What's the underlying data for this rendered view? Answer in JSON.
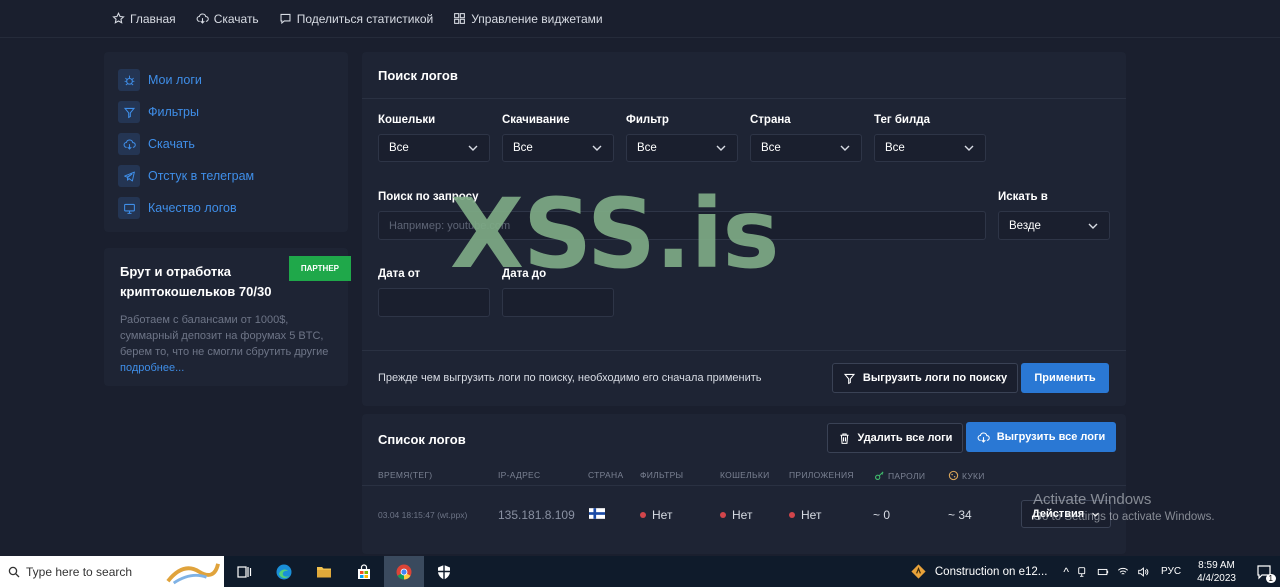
{
  "topnav": {
    "items": [
      {
        "label": "Главная",
        "icon": "star-icon"
      },
      {
        "label": "Скачать",
        "icon": "cloud-download-icon"
      },
      {
        "label": "Поделиться статистикой",
        "icon": "share-icon"
      },
      {
        "label": "Управление виджетами",
        "icon": "widgets-icon"
      }
    ]
  },
  "sidebar": {
    "items": [
      {
        "label": "Мои логи",
        "icon": "bug-icon"
      },
      {
        "label": "Фильтры",
        "icon": "filter-icon"
      },
      {
        "label": "Скачать",
        "icon": "cloud-download-icon"
      },
      {
        "label": "Отстук в телеграм",
        "icon": "telegram-icon"
      },
      {
        "label": "Качество логов",
        "icon": "monitor-icon"
      }
    ]
  },
  "promo": {
    "title": "Брут и отработка криптокошельков 70/30",
    "badge": "ПАРТНЕР",
    "text": "Работаем с балансами от 1000$, суммарный депозит на форумах 5 BTC, берем то, что не смогли сбрутить другие",
    "link": "подробнее..."
  },
  "search_panel": {
    "title": "Поиск логов",
    "filters": [
      {
        "label": "Кошельки",
        "value": "Все"
      },
      {
        "label": "Скачивание",
        "value": "Все"
      },
      {
        "label": "Фильтр",
        "value": "Все"
      },
      {
        "label": "Страна",
        "value": "Все"
      },
      {
        "label": "Тег билда",
        "value": "Все"
      }
    ],
    "query_label": "Поиск по запросу",
    "query_placeholder": "Например: youtube.com",
    "search_in_label": "Искать в",
    "search_in_value": "Везде",
    "date_from_label": "Дата от",
    "date_to_label": "Дата до",
    "note": "Прежде чем выгрузить логи по поиску, необходимо его сначала применить",
    "export_button": "Выгрузить логи по поиску",
    "apply_button": "Применить"
  },
  "logs_list": {
    "title": "Список логов",
    "delete_all_button": "Удалить все логи",
    "export_all_button": "Выгрузить все логи",
    "columns": [
      "ВРЕМЯ(ТЕГ)",
      "IP-АДРЕС",
      "СТРАНА",
      "ФИЛЬТРЫ",
      "КОШЕЛЬКИ",
      "ПРИЛОЖЕНИЯ",
      "ПАРОЛИ",
      "КУКИ"
    ],
    "rows": [
      {
        "time": "03.04 18:15:47 (wt.ppx)",
        "ip": "135.181.8.109",
        "country": "FI",
        "filters": "Нет",
        "wallets": "Нет",
        "apps": "Нет",
        "passwords": "~ 0",
        "cookies": "~ 34",
        "actions": "Действия"
      }
    ]
  },
  "watermark": "XSS.is",
  "activate_windows": {
    "line1": "Activate Windows",
    "line2": "Go to Settings to activate Windows."
  },
  "taskbar": {
    "search_placeholder": "Type here to search",
    "notification_text": "Construction on e12...",
    "language": "РУС",
    "time": "8:59 AM",
    "date": "4/4/2023",
    "notification_count": "1"
  },
  "colors": {
    "background": "#1a1f2e",
    "panel": "#1e2434",
    "accent": "#2a78d4",
    "link": "#3f8ee8",
    "partner_badge": "#1fa84a",
    "status_dot": "#d2454b",
    "watermark": "#7eaa86"
  }
}
